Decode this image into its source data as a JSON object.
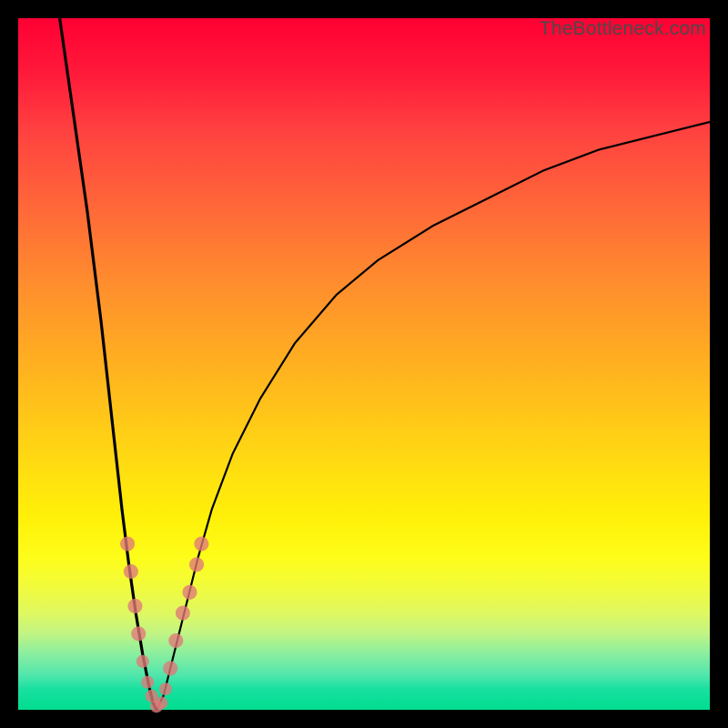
{
  "watermark": "TheBottleneck.com",
  "chart_data": {
    "type": "line",
    "title": "",
    "xlabel": "",
    "ylabel": "",
    "xlim": [
      0,
      100
    ],
    "ylim": [
      0,
      100
    ],
    "background_gradient": {
      "top": "#ff0033",
      "upper_mid": "#ff8c2e",
      "mid": "#ffe010",
      "lower_mid": "#fdfd1a",
      "bottom": "#00dd90"
    },
    "series": [
      {
        "name": "curve-left",
        "x": [
          6,
          8,
          10,
          12,
          14,
          15,
          16,
          17,
          18,
          19,
          19.5,
          20
        ],
        "y": [
          100,
          86,
          72,
          56,
          38,
          29,
          21,
          14,
          8,
          3,
          1,
          0
        ],
        "stroke_width": 3.2
      },
      {
        "name": "curve-right",
        "x": [
          20,
          21,
          22,
          24,
          26,
          28,
          31,
          35,
          40,
          46,
          52,
          60,
          68,
          76,
          84,
          92,
          100
        ],
        "y": [
          0,
          2,
          6,
          14,
          22,
          29,
          37,
          45,
          53,
          60,
          65,
          70,
          74,
          78,
          81,
          83,
          85
        ],
        "stroke_width": 2.2
      }
    ],
    "markers": [
      {
        "x": 15.8,
        "y": 24,
        "r": 8
      },
      {
        "x": 16.3,
        "y": 20,
        "r": 8
      },
      {
        "x": 16.9,
        "y": 15,
        "r": 8
      },
      {
        "x": 17.4,
        "y": 11,
        "r": 8
      },
      {
        "x": 18.0,
        "y": 7,
        "r": 7
      },
      {
        "x": 18.7,
        "y": 4,
        "r": 7
      },
      {
        "x": 19.3,
        "y": 2,
        "r": 7
      },
      {
        "x": 20.0,
        "y": 0.5,
        "r": 7
      },
      {
        "x": 20.7,
        "y": 1,
        "r": 7
      },
      {
        "x": 21.3,
        "y": 3,
        "r": 7
      },
      {
        "x": 22.0,
        "y": 6,
        "r": 8
      },
      {
        "x": 22.8,
        "y": 10,
        "r": 8
      },
      {
        "x": 23.8,
        "y": 14,
        "r": 8
      },
      {
        "x": 24.8,
        "y": 17,
        "r": 8
      },
      {
        "x": 25.8,
        "y": 21,
        "r": 8
      },
      {
        "x": 26.5,
        "y": 24,
        "r": 8
      }
    ]
  }
}
